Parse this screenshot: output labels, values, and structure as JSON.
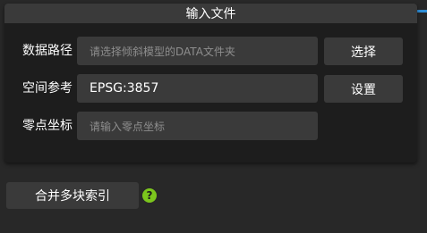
{
  "panel": {
    "title": "输入文件",
    "rows": [
      {
        "label": "数据路径",
        "placeholder": "请选择倾斜模型的DATA文件夹",
        "value": "",
        "button": "选择"
      },
      {
        "label": "空间参考",
        "placeholder": "",
        "value": "EPSG:3857",
        "button": "设置"
      },
      {
        "label": "零点坐标",
        "placeholder": "请输入零点坐标",
        "value": ""
      }
    ]
  },
  "actions": {
    "merge_index_label": "合并多块索引",
    "help_glyph": "?"
  },
  "colors": {
    "background": "#282828",
    "panel": "#1d1d1d",
    "control": "#3a3a3a",
    "accent": "#2f8fd8",
    "help": "#7cc61d",
    "placeholder_text": "#8e8e8e"
  }
}
